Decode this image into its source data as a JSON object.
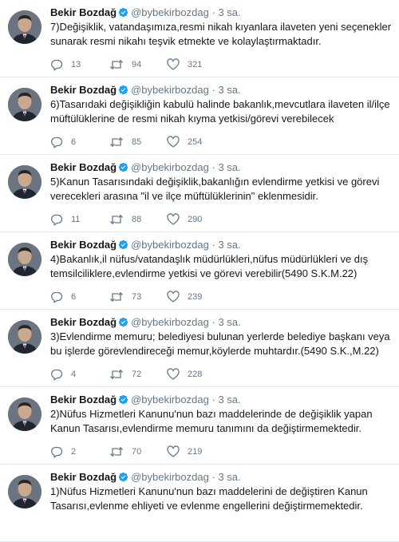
{
  "tweets": [
    {
      "name": "Bekir Bozdağ",
      "handle": "@bybekirbozdag",
      "separator": "·",
      "time": "3 sa.",
      "text": "7)Değişiklik, vatandaşımıza,resmi nikah kıyanlara ilaveten yeni seçenekler sunarak resmi nikahı teşvik etmekte ve kolaylaştırmaktadır.",
      "replies": "13",
      "retweets": "94",
      "likes": "321"
    },
    {
      "name": "Bekir Bozdağ",
      "handle": "@bybekirbozdag",
      "separator": "·",
      "time": "3 sa.",
      "text": "6)Tasarıdaki değişikliğin kabulü halinde bakanlık,mevcutlara ilaveten il/ilçe müftülüklerine de resmi nikah kıyma yetkisi/görevi verebilecek",
      "replies": "6",
      "retweets": "85",
      "likes": "254"
    },
    {
      "name": "Bekir Bozdağ",
      "handle": "@bybekirbozdag",
      "separator": "·",
      "time": "3 sa.",
      "text": "5)Kanun Tasarısındaki değişiklik,bakanlığın evlendirme yetkisi ve görevi verecekleri arasına \"il ve ilçe müftülüklerinin\" eklenmesidir.",
      "replies": "11",
      "retweets": "88",
      "likes": "290"
    },
    {
      "name": "Bekir Bozdağ",
      "handle": "@bybekirbozdag",
      "separator": "·",
      "time": "3 sa.",
      "text": "4)Bakanlık,il nüfus/vatandaşlık müdürlükleri,nüfus müdürlükleri ve dış temsilciliklere,evlendirme yetkisi ve görevi verebilir(5490 S.K.M.22)",
      "replies": "6",
      "retweets": "73",
      "likes": "239"
    },
    {
      "name": "Bekir Bozdağ",
      "handle": "@bybekirbozdag",
      "separator": "·",
      "time": "3 sa.",
      "text": "3)Evlendirme memuru; belediyesi bulunan yerlerde belediye başkanı veya bu işlerde görevlendireceği memur,köylerde muhtardır.(5490 S.K.,M.22)",
      "replies": "4",
      "retweets": "72",
      "likes": "228"
    },
    {
      "name": "Bekir Bozdağ",
      "handle": "@bybekirbozdag",
      "separator": "·",
      "time": "3 sa.",
      "text": "2)Nüfus Hizmetleri Kanunu'nun bazı maddelerinde de değişiklik yapan Kanun Tasarısı,evlendirme memuru tanımını da değiştirmemektedir.",
      "replies": "2",
      "retweets": "70",
      "likes": "219"
    },
    {
      "name": "Bekir Bozdağ",
      "handle": "@bybekirbozdag",
      "separator": "·",
      "time": "3 sa.",
      "text": "1)Nüfus Hizmetleri Kanunu'nun bazı maddelerini de değiştiren Kanun Tasarısı,evlenme ehliyeti ve evlenme engellerini değiştirmemektedir.",
      "replies": "",
      "retweets": "",
      "likes": ""
    }
  ],
  "colors": {
    "verified": "#1da1f2",
    "secondary_text": "#657786",
    "divider": "#e1e8ed"
  },
  "icons": {
    "verified": "verified-badge-icon",
    "reply": "reply-icon",
    "retweet": "retweet-icon",
    "like": "heart-icon"
  }
}
